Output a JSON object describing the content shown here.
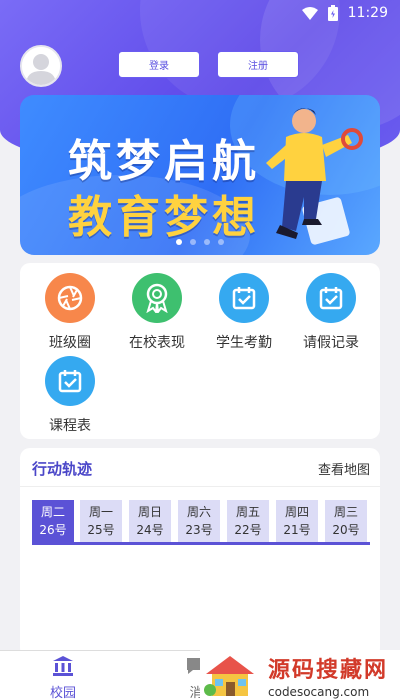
{
  "status_bar": {
    "time": "11:29",
    "icons": [
      "wifi-icon",
      "battery-icon"
    ]
  },
  "header": {
    "login_label": "登录",
    "register_label": "注册"
  },
  "banner": {
    "title_line1": "筑梦启航",
    "title_line2": "教育梦想",
    "slide_count": 4,
    "active_slide": 1
  },
  "menu": [
    {
      "label": "班级圈",
      "icon": "aperture-icon",
      "color": "#f7874b"
    },
    {
      "label": "在校表现",
      "icon": "medal-icon",
      "color": "#3ec06f"
    },
    {
      "label": "学生考勤",
      "icon": "calendar-check-icon",
      "color": "#35a9f0"
    },
    {
      "label": "请假记录",
      "icon": "calendar-check-icon",
      "color": "#35a9f0"
    },
    {
      "label": "课程表",
      "icon": "calendar-check-icon",
      "color": "#35a9f0"
    }
  ],
  "track": {
    "title": "行动轨迹",
    "map_link": "查看地图",
    "days": [
      {
        "weekday": "周二",
        "date": "26号",
        "active": true
      },
      {
        "weekday": "周一",
        "date": "25号",
        "active": false
      },
      {
        "weekday": "周日",
        "date": "24号",
        "active": false
      },
      {
        "weekday": "周六",
        "date": "23号",
        "active": false
      },
      {
        "weekday": "周五",
        "date": "22号",
        "active": false
      },
      {
        "weekday": "周四",
        "date": "21号",
        "active": false
      },
      {
        "weekday": "周三",
        "date": "20号",
        "active": false
      }
    ]
  },
  "bottom_nav": {
    "items": [
      {
        "label": "校园",
        "icon": "school-icon",
        "active": true
      },
      {
        "label": "消",
        "icon": "message-icon",
        "active": false
      }
    ]
  },
  "watermark": {
    "title": "源码搜藏网",
    "domain": "codesocang.com"
  },
  "colors": {
    "primary": "#5b52d6",
    "header_gradient_start": "#7a6cf6",
    "banner_blue": "#2f6ef5",
    "banner_yellow": "#ffd23f"
  }
}
